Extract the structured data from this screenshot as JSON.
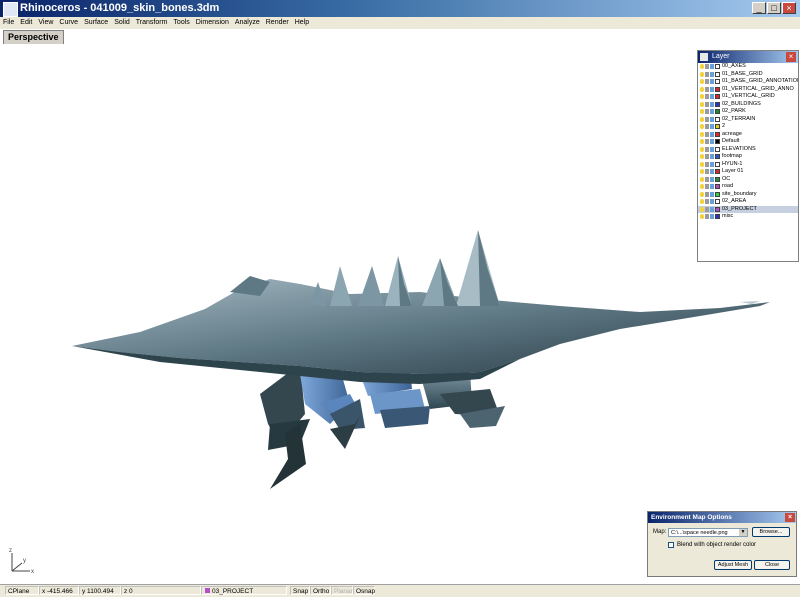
{
  "window": {
    "title": "Rhinoceros - 041009_skin_bones.3dm",
    "controls": {
      "minimize": "_",
      "maximize": "□",
      "close": "×"
    }
  },
  "menu": [
    "File",
    "Edit",
    "View",
    "Curve",
    "Surface",
    "Solid",
    "Transform",
    "Tools",
    "Dimension",
    "Analyze",
    "Render",
    "Help"
  ],
  "viewport": {
    "label": "Perspective"
  },
  "layers_panel": {
    "title": "Layer",
    "close": "×",
    "layers": [
      {
        "name": "00_AXES",
        "color": "#ffffff"
      },
      {
        "name": "01_BASE_GRID",
        "color": "#ffffff"
      },
      {
        "name": "01_BASE_GRID_ANNOTATION",
        "color": "#ffffff"
      },
      {
        "name": "01_VERTICAL_GRID_ANNO",
        "color": "#d9262a"
      },
      {
        "name": "01_VERTICAL_GRID",
        "color": "#d9262a"
      },
      {
        "name": "02_BUILDINGS",
        "color": "#2633c9"
      },
      {
        "name": "02_PARK",
        "color": "#1a8a2e"
      },
      {
        "name": "02_TERRAIN",
        "color": "#ffffff"
      },
      {
        "name": "2",
        "color": "#e6c91f"
      },
      {
        "name": "acreage",
        "color": "#e8262a"
      },
      {
        "name": "Default",
        "color": "#000000"
      },
      {
        "name": "ELEVATIONS",
        "color": "#ffffff"
      },
      {
        "name": "footmap",
        "color": "#2a57d3"
      },
      {
        "name": "HYUN-1",
        "color": "#ffffff"
      },
      {
        "name": "Layer 01",
        "color": "#d9262a"
      },
      {
        "name": "OC",
        "color": "#2a8e3a"
      },
      {
        "name": "road",
        "color": "#b44ab8"
      },
      {
        "name": "site_boundary",
        "color": "#2ad33a"
      },
      {
        "name": "02_AREA",
        "color": "#ffffff"
      },
      {
        "name": "03_PROJECT",
        "color": "#b64fc7",
        "selected": true
      },
      {
        "name": "misc",
        "color": "#2a36c2"
      }
    ]
  },
  "env_dialog": {
    "title": "Environment Map Options",
    "close": "×",
    "map_label": "Map:",
    "map_value": "C:\\...\\space needle.png",
    "browse": "Browse...",
    "blend_label": "Blend with object render color",
    "adjust": "Adjust Mesh",
    "close_btn": "Close"
  },
  "axis": {
    "x": "x",
    "y": "y",
    "z": "z"
  },
  "status": {
    "cplane": "CPlane",
    "x": "x -415.466",
    "y": "y 1100.494",
    "z": "z 0",
    "layer": "03_PROJECT",
    "layer_color": "#b64fc7",
    "snap": "Snap",
    "ortho": "Ortho",
    "planar": "Planar",
    "osnap": "Osnap"
  }
}
